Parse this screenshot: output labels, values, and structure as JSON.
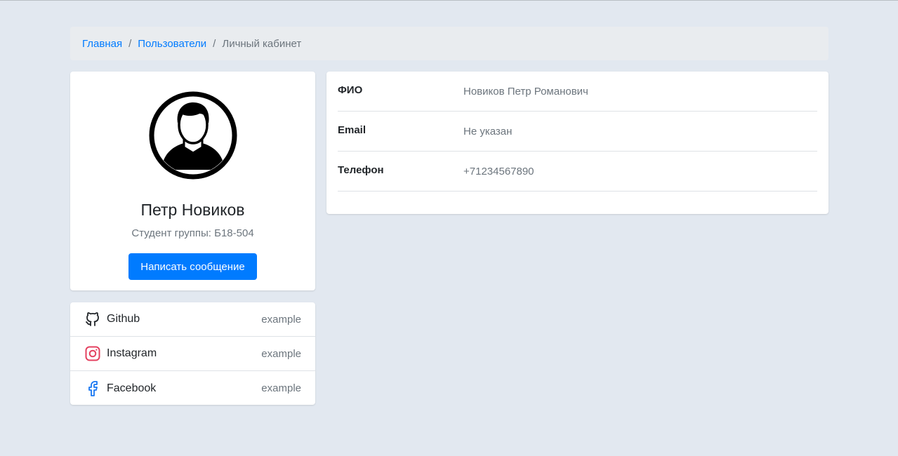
{
  "breadcrumb": {
    "items": [
      "Главная",
      "Пользователи"
    ],
    "separator": "/",
    "current": "Личный кабинет"
  },
  "profile": {
    "name": "Петр Новиков",
    "subtitle": "Студент группы: Б18-504",
    "message_button": "Написать сообщение",
    "avatar_icon": "user-avatar-icon"
  },
  "social": [
    {
      "name": "Github",
      "value": "example",
      "icon": "github-icon"
    },
    {
      "name": "Instagram",
      "value": "example",
      "icon": "instagram-icon"
    },
    {
      "name": "Facebook",
      "value": "example",
      "icon": "facebook-icon"
    }
  ],
  "info": [
    {
      "label": "ФИО",
      "value": "Новиков Петр Романович"
    },
    {
      "label": "Email",
      "value": "Не указан"
    },
    {
      "label": "Телефон",
      "value": "+71234567890"
    }
  ],
  "colors": {
    "background": "#e2e8f0",
    "accent": "#007bff",
    "instagram": "#e4405f",
    "facebook": "#1877f2"
  }
}
